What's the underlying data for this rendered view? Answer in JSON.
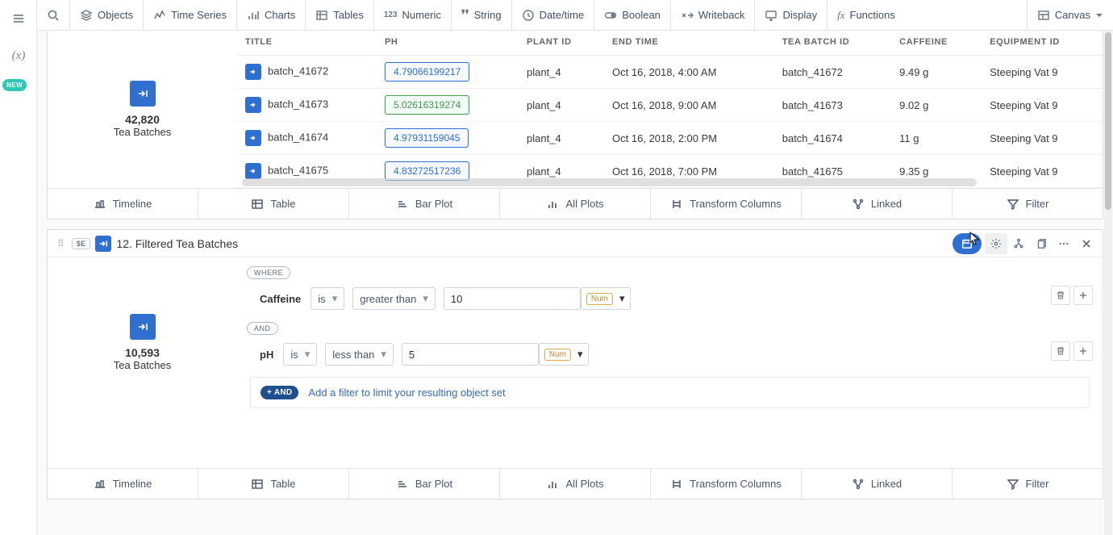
{
  "toolbar": {
    "objects": "Objects",
    "time_series": "Time Series",
    "charts": "Charts",
    "tables": "Tables",
    "numeric": "Numeric",
    "string": "String",
    "datetime": "Date/time",
    "boolean": "Boolean",
    "writeback": "Writeback",
    "display": "Display",
    "functions": "Functions",
    "canvas": "Canvas"
  },
  "left_rail": {
    "new_badge": "NEW"
  },
  "top_panel": {
    "count": "42,820",
    "label": "Tea Batches",
    "columns": [
      "TITLE",
      "PH",
      "PLANT ID",
      "END TIME",
      "TEA BATCH ID",
      "CAFFEINE",
      "EQUIPMENT ID"
    ],
    "rows": [
      {
        "title": "batch_41672",
        "ph": "4.79066199217",
        "ph_style": "blue",
        "plant": "plant_4",
        "end": "Oct 16, 2018, 4:00 AM",
        "batch": "batch_41672",
        "caff": "9.49 g",
        "equip": "Steeping Vat 9"
      },
      {
        "title": "batch_41673",
        "ph": "5.02616319274",
        "ph_style": "green",
        "plant": "plant_4",
        "end": "Oct 16, 2018, 9:00 AM",
        "batch": "batch_41673",
        "caff": "9.02 g",
        "equip": "Steeping Vat 9"
      },
      {
        "title": "batch_41674",
        "ph": "4.97931159045",
        "ph_style": "blue",
        "plant": "plant_4",
        "end": "Oct 16, 2018, 2:00 PM",
        "batch": "batch_41674",
        "caff": "11 g",
        "equip": "Steeping Vat 9"
      },
      {
        "title": "batch_41675",
        "ph": "4.83272517236",
        "ph_style": "blue",
        "plant": "plant_4",
        "end": "Oct 16, 2018, 7:00 PM",
        "batch": "batch_41675",
        "caff": "9.35 g",
        "equip": "Steeping Vat 9"
      }
    ]
  },
  "tabs": {
    "timeline": "Timeline",
    "table": "Table",
    "bar_plot": "Bar Plot",
    "all_plots": "All Plots",
    "transform": "Transform Columns",
    "linked": "Linked",
    "filter": "Filter"
  },
  "bottom_panel": {
    "badge": "$E",
    "title": "12. Filtered Tea Batches",
    "count": "10,593",
    "label": "Tea Batches",
    "where": "WHERE",
    "and": "AND",
    "cond1": {
      "field": "Caffeine",
      "op1": "is",
      "op2": "greater than",
      "value": "10",
      "type": "Num"
    },
    "cond2": {
      "field": "pH",
      "op1": "is",
      "op2": "less than",
      "value": "5",
      "type": "Num"
    },
    "plus_and": "+ AND",
    "add_hint": "Add a filter to limit your resulting object set"
  }
}
